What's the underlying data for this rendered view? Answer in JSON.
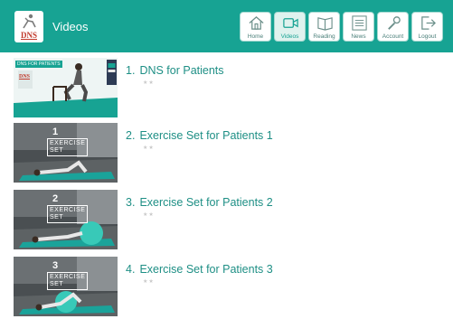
{
  "header": {
    "title": "Videos",
    "logo_text": "DNS",
    "nav": [
      {
        "label": "Home",
        "icon": "home-icon"
      },
      {
        "label": "Videos",
        "icon": "video-camera-icon",
        "active": true
      },
      {
        "label": "Reading",
        "icon": "book-icon"
      },
      {
        "label": "News",
        "icon": "news-lines-icon"
      },
      {
        "label": "Account",
        "icon": "wrench-icon"
      },
      {
        "label": "Logout",
        "icon": "logout-icon"
      }
    ]
  },
  "videos": [
    {
      "number": "1.",
      "title": "DNS for Patients",
      "rating": "★★",
      "thumb_caption": "DNS FOR PATIENTS",
      "thumb_logo": "DNS"
    },
    {
      "number": "2.",
      "title": "Exercise Set for Patients 1",
      "rating": "★★",
      "thumb_num": "1",
      "thumb_line1": "EXERCISE",
      "thumb_line2": "SET"
    },
    {
      "number": "3.",
      "title": "Exercise Set for Patients 2",
      "rating": "★★",
      "thumb_num": "2",
      "thumb_line1": "EXERCISE",
      "thumb_line2": "SET"
    },
    {
      "number": "4.",
      "title": "Exercise Set for Patients 3",
      "rating": "★★",
      "thumb_num": "3",
      "thumb_line1": "EXERCISE",
      "thumb_line2": "SET"
    }
  ],
  "colors": {
    "accent": "#17a393",
    "title": "#1e8f85",
    "mat": "#1aa39a",
    "ball": "#38c9b8"
  }
}
